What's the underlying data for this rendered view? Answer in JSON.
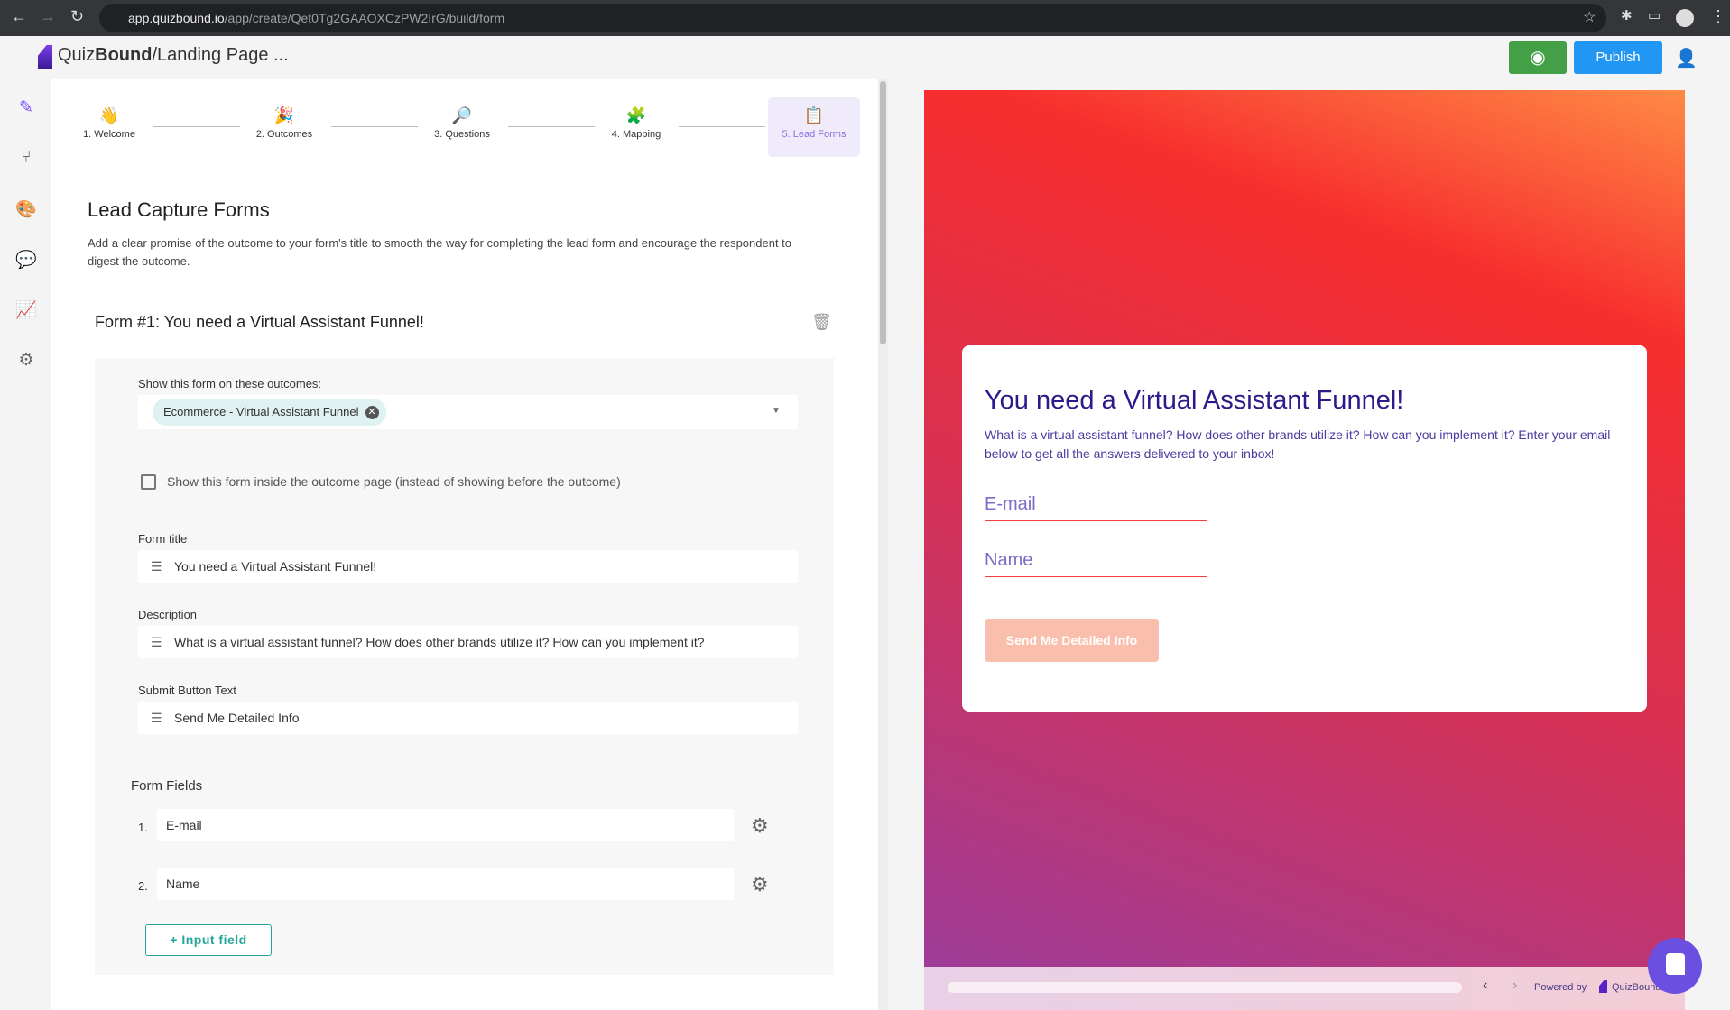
{
  "browser": {
    "url_host": "app.quizbound.io",
    "url_path": "/app/create/Qet0Tg2GAAOXCzPW2IrG/build/form"
  },
  "header": {
    "brand_quiz": "Quiz",
    "brand_bound": "Bound",
    "breadcrumb": "/Landing Page ...",
    "publish_label": "Publish"
  },
  "stepper": [
    {
      "label": "1. Welcome",
      "icon": "👋"
    },
    {
      "label": "2. Outcomes",
      "icon": "🎉"
    },
    {
      "label": "3. Questions",
      "icon": "🔎"
    },
    {
      "label": "4. Mapping",
      "icon": "🧩"
    },
    {
      "label": "5. Lead Forms",
      "icon": "📋"
    }
  ],
  "page": {
    "title": "Lead Capture Forms",
    "description": "Add a clear promise of the outcome to your form's title to smooth the way for completing the lead form and encourage the respondent to digest the outcome."
  },
  "form": {
    "heading": "Form #1: You need a Virtual Assistant Funnel!",
    "outcomes_label": "Show this form on these outcomes:",
    "outcome_chip": "Ecommerce - Virtual Assistant Funnel",
    "checkbox_label": "Show this form inside the outcome page (instead of showing before the outcome)",
    "title_label": "Form title",
    "title_value": "You need a Virtual Assistant Funnel!",
    "description_label": "Description",
    "description_value": "What is a virtual assistant funnel? How does other brands utilize it? How can you implement it?",
    "submit_label": "Submit Button Text",
    "submit_value": "Send Me Detailed Info",
    "fields_label": "Form Fields",
    "fields": [
      {
        "num": "1.",
        "value": "E-mail"
      },
      {
        "num": "2.",
        "value": "Name"
      }
    ],
    "add_field_label": "+ Input field"
  },
  "preview": {
    "title": "You need a Virtual Assistant Funnel!",
    "description": "What is a virtual assistant funnel? How does other brands utilize it? How can you implement it? Enter your email below to get all the answers delivered to your inbox!",
    "email_placeholder": "E-mail",
    "name_placeholder": "Name",
    "button": "Send Me Detailed Info",
    "powered_by": "Powered by",
    "powered_brand": "QuizBound"
  }
}
